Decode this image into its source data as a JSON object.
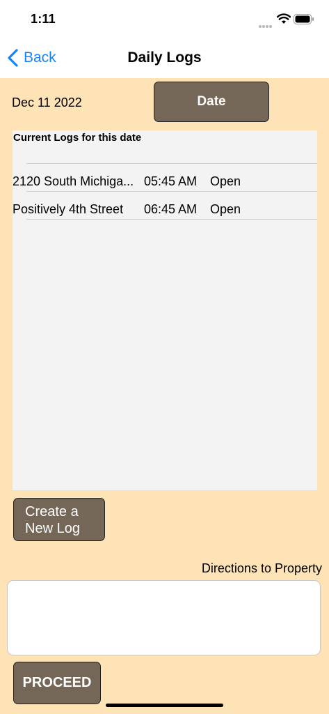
{
  "status_bar": {
    "time": "1:11"
  },
  "nav": {
    "back_label": "Back",
    "title": "Daily Logs"
  },
  "date_section": {
    "selected_date": "Dec 11 2022",
    "date_button_label": "Date"
  },
  "logs": {
    "header": "Current Logs for this date",
    "rows": [
      {
        "name": "2120 South Michiga...",
        "time": "05:45 AM",
        "status": "Open"
      },
      {
        "name": "Positively 4th Street",
        "time": "06:45 AM",
        "status": "Open"
      }
    ]
  },
  "actions": {
    "create_label_line1": "Create a",
    "create_label_line2": "New Log",
    "directions_label": "Directions to Property",
    "directions_value": "",
    "proceed_label": "PROCEED"
  },
  "colors": {
    "background": "#fde3b6",
    "button": "#756757",
    "accent": "#1a82f8",
    "table_background": "#f3f3f3"
  },
  "icons": [
    "signal-dots-icon",
    "wifi-icon",
    "battery-icon",
    "chevron-left-icon"
  ]
}
